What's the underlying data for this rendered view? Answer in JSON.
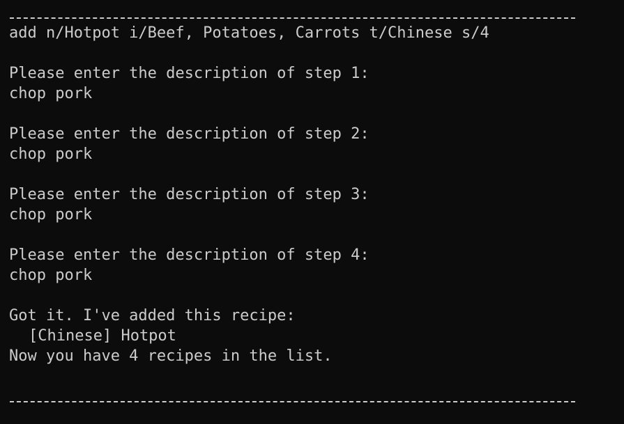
{
  "terminal": {
    "command": "add n/Hotpot i/Beef, Potatoes, Carrots t/Chinese s/4",
    "steps": [
      {
        "prompt": "Please enter the description of step 1:",
        "input": "chop pork"
      },
      {
        "prompt": "Please enter the description of step 2:",
        "input": "chop pork"
      },
      {
        "prompt": "Please enter the description of step 3:",
        "input": "chop pork"
      },
      {
        "prompt": "Please enter the description of step 4:",
        "input": "chop pork"
      }
    ],
    "confirmation": "Got it. I've added this recipe:",
    "recipe_entry": "[Chinese] Hotpot",
    "summary": "Now you have 4 recipes in the list."
  },
  "colors": {
    "background": "#0c0c0c",
    "text": "#cccccc"
  }
}
